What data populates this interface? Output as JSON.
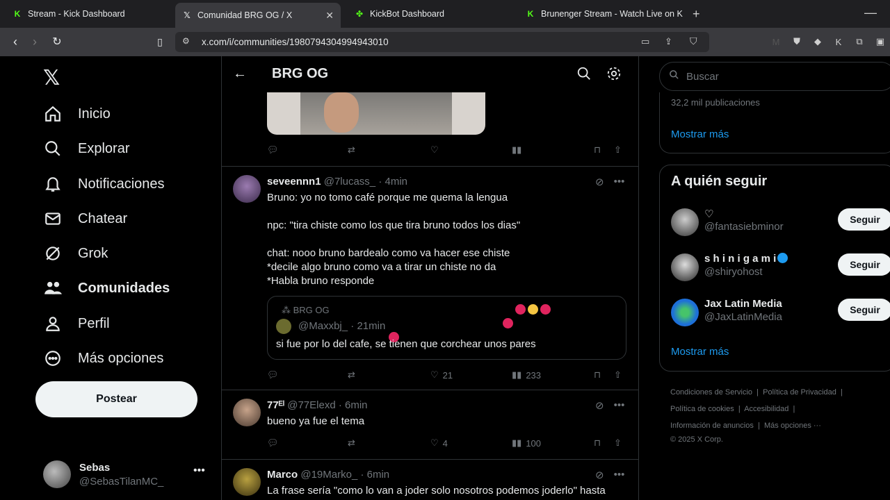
{
  "browser": {
    "tabs": [
      {
        "title": "Stream - Kick Dashboard",
        "icon": "kick-icon"
      },
      {
        "title": "Comunidad BRG OG / X",
        "icon": "x-icon"
      },
      {
        "title": "KickBot Dashboard",
        "icon": "kickbot-icon"
      },
      {
        "title": "Brunenger Stream - Watch Live on Ki",
        "icon": "kick-icon"
      }
    ],
    "url": "x.com/i/communities/1980794304994943010"
  },
  "nav": {
    "items": [
      {
        "label": "Inicio",
        "icon": "home-icon"
      },
      {
        "label": "Explorar",
        "icon": "search-icon"
      },
      {
        "label": "Notificaciones",
        "icon": "bell-icon"
      },
      {
        "label": "Chatear",
        "icon": "mail-icon"
      },
      {
        "label": "Grok",
        "icon": "grok-icon"
      },
      {
        "label": "Comunidades",
        "icon": "communities-icon"
      },
      {
        "label": "Perfil",
        "icon": "person-icon"
      },
      {
        "label": "Más opciones",
        "icon": "more-circle-icon"
      }
    ],
    "post_label": "Postear",
    "account": {
      "name": "Sebas",
      "handle": "@SebasTilanMC_"
    }
  },
  "header": {
    "title": "BRG OG"
  },
  "posts": [
    {
      "name": "seveennn1",
      "handle": "@7lucass_",
      "time": "4min",
      "text": "Bruno: yo no tomo café porque me quema la lengua\n\nnpc: \"tira chiste como los que tira bruno todos los dias\"\n\nchat: nooo bruno bardealo como va  hacer ese chiste\n*decile algo bruno como va a tirar un chiste no da\n*Habla bruno responde",
      "quote": {
        "community": "BRG OG",
        "handle": "@Maxxbj_",
        "time": "21min",
        "text": "si fue por lo del cafe, se tienen que corchear unos pares"
      },
      "likes": "21",
      "views": "233"
    },
    {
      "name": "77ᴱˡ",
      "handle": "@77Elexd",
      "time": "6min",
      "text": "bueno ya fue el tema",
      "likes": "4",
      "views": "100"
    },
    {
      "name": "Marco",
      "handle": "@19Marko_",
      "time": "6min",
      "text": "La frase sería \"como lo van a joder solo nosotros podemos joderlo\" hasta"
    }
  ],
  "sidebar": {
    "search_placeholder": "Buscar",
    "trend_count": "32,2 mil publicaciones",
    "show_more": "Mostrar más",
    "follow_title": "A quién seguir",
    "follow_button": "Seguir",
    "users": [
      {
        "name": "♡",
        "handle": "@fantasiebminor"
      },
      {
        "name": "s h i n i g a m i",
        "handle": "@shiryohost"
      },
      {
        "name": "Jax Latin Media",
        "handle": "@JaxLatinMedia"
      }
    ],
    "footer": {
      "links": [
        "Condiciones de Servicio",
        "Política de Privacidad",
        "Política de cookies",
        "Accesibilidad",
        "Información de anuncios",
        "Más opciones ···"
      ],
      "copyright": "© 2025 X Corp."
    }
  },
  "colors": {
    "accent": "#1d9bf0",
    "background": "#000000",
    "muted": "#71767b",
    "kick_green": "#53fc18"
  }
}
